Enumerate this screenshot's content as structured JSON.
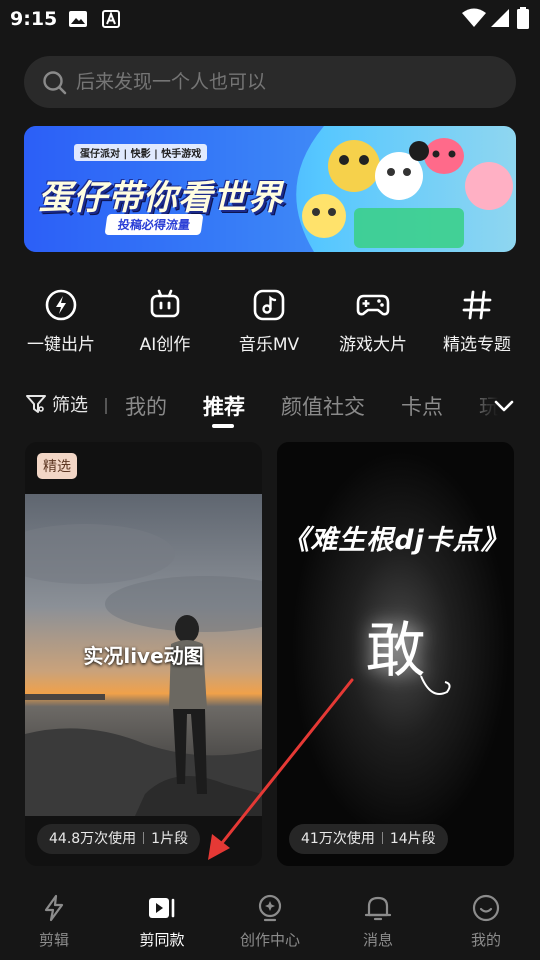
{
  "status_bar": {
    "time": "9:15"
  },
  "search": {
    "placeholder": "后来发现一个人也可以"
  },
  "banner": {
    "brands": "蛋仔派对 | 快影 | 快手游戏",
    "title": "蛋仔带你看世界",
    "pill": "投稿必得流量"
  },
  "tools": [
    {
      "label": "一键出片",
      "icon": "lightning-circle-icon"
    },
    {
      "label": "AI创作",
      "icon": "robot-icon"
    },
    {
      "label": "音乐MV",
      "icon": "music-note-icon"
    },
    {
      "label": "游戏大片",
      "icon": "gamepad-icon"
    },
    {
      "label": "精选专题",
      "icon": "hashtag-icon"
    }
  ],
  "tabs": {
    "filter_label": "筛选",
    "items": [
      "我的",
      "推荐",
      "颜值社交",
      "卡点",
      "玩"
    ],
    "active": "推荐"
  },
  "cards": [
    {
      "badge": "精选",
      "overlay_text": "实况live动图",
      "uses": "44.8万次使用",
      "segments": "1片段"
    },
    {
      "overlay_text": "《难生根dj卡点》",
      "center_char": "敢",
      "uses": "41万次使用",
      "segments": "14片段"
    }
  ],
  "bottom_nav": [
    {
      "label": "剪辑",
      "icon": "lightning-icon"
    },
    {
      "label": "剪同款",
      "icon": "video-play-icon"
    },
    {
      "label": "创作中心",
      "icon": "bulb-icon"
    },
    {
      "label": "消息",
      "icon": "bell-icon"
    },
    {
      "label": "我的",
      "icon": "smile-icon"
    }
  ],
  "active_nav": "剪同款",
  "colors": {
    "background": "#161616",
    "accent_arrow": "#e53935",
    "badge_bg": "#f2d6c6"
  }
}
